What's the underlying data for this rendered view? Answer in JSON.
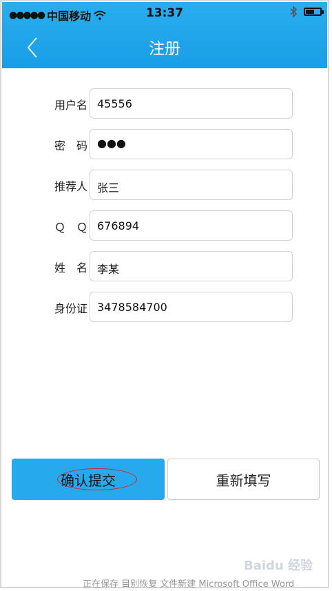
{
  "status_bar": {
    "signal": "●●●●●",
    "carrier": "中国移动",
    "time": "13:37"
  },
  "nav": {
    "title": "注册"
  },
  "form": {
    "rows": [
      {
        "label": "用户名",
        "value": "45556"
      },
      {
        "label": "密　码",
        "value": "●●●"
      },
      {
        "label": "推荐人",
        "value": "张三"
      },
      {
        "label": "Ｑ　Ｑ",
        "value": "676894"
      },
      {
        "label": "姓　名",
        "value": "李某"
      },
      {
        "label": "身份证",
        "value": "3478584700"
      }
    ]
  },
  "buttons": {
    "submit": "确认提交",
    "reset": "重新填写"
  },
  "annotation_color": "#d6232a",
  "accent_color": "#27a9ee",
  "watermark": "Baidu 经验",
  "taskbar_text": "正在保存  目别恢复  文件新建 Microsoft Office Word"
}
